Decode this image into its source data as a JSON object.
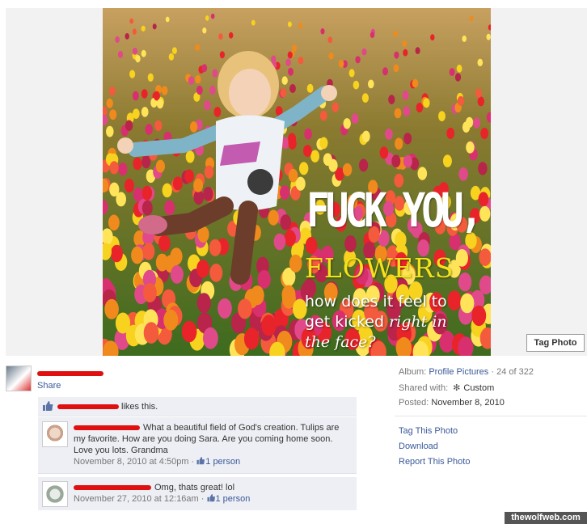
{
  "photo": {
    "overlay_line1": "FUCK YOU,",
    "overlay_line2": "FLOWERS",
    "overlay_line3": "how does it feel to",
    "overlay_line4_plain": "get kicked ",
    "overlay_line4_italic": "right in",
    "overlay_line5": "the face?",
    "tag_button": "Tag Photo"
  },
  "owner": {
    "share_label": "Share"
  },
  "likes": {
    "text": "likes this."
  },
  "comments": [
    {
      "text": "What a beautiful field of God's creation. Tulips are my favorite. How are you doing Sara. Are you coming home soon. Love you lots. Grandma",
      "time": "November 8, 2010 at 4:50pm",
      "separator": " · ",
      "likes": "1 person"
    },
    {
      "text": "Omg, thats great! lol",
      "time": "November 27, 2010 at 12:16am",
      "separator": " · ",
      "likes": "1 person"
    }
  ],
  "meta": {
    "album_label": "Album:",
    "album_name": "Profile Pictures",
    "album_position": "· 24 of 322",
    "shared_label": "Shared with:",
    "shared_value": "Custom",
    "posted_label": "Posted:",
    "posted_value": "November 8, 2010"
  },
  "actions": {
    "tag": "Tag This Photo",
    "download": "Download",
    "report": "Report This Photo"
  },
  "watermark": "thewolfweb.com",
  "colors": {
    "link": "#3b5998",
    "redaction": "#e01010",
    "feedback_bg": "#edeff4",
    "flowers_yellow": "#f5e31a"
  }
}
